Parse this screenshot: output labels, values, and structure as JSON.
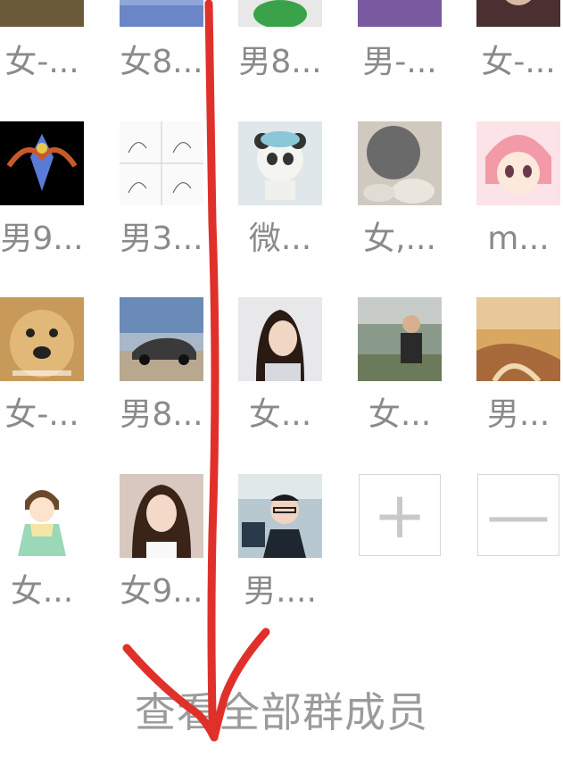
{
  "rows": [
    {
      "names": [
        "女-...",
        "女8...",
        "男8...",
        "男-...",
        "女-..."
      ]
    },
    {
      "names": [
        "男9...",
        "男3...",
        "微...",
        "女,...",
        "m..."
      ]
    },
    {
      "names": [
        "女-...",
        "男8...",
        "女...",
        "女...",
        "男..."
      ]
    },
    {
      "names": [
        "女...",
        "女9...",
        "男...."
      ]
    }
  ],
  "controls": {
    "add_icon": "plus-icon",
    "remove_icon": "minus-icon",
    "add_glyph": "+",
    "remove_glyph": "—"
  },
  "footer": {
    "view_all_label": "查看全部群成员"
  },
  "colors": {
    "annotation_arrow": "#e0302a",
    "label_gray": "#8a8a8a",
    "border_gray": "#d6d6d6"
  }
}
